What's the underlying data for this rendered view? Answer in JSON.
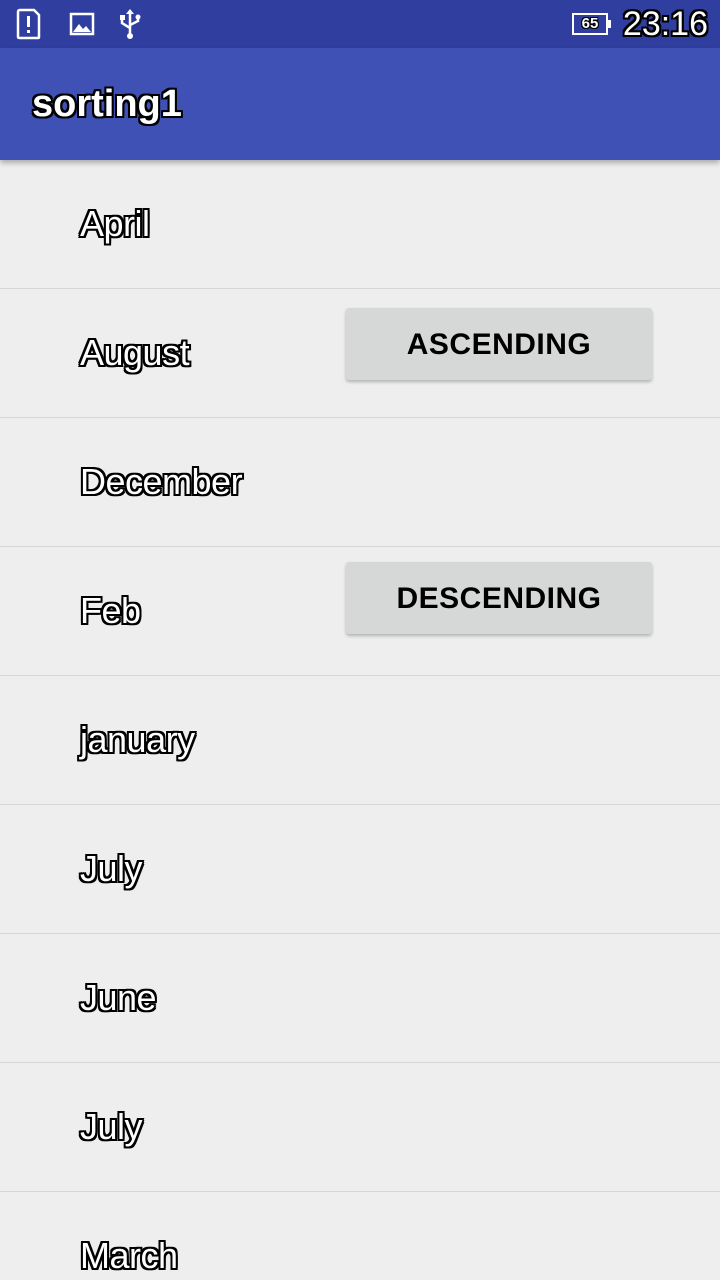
{
  "status_bar": {
    "icons": [
      "sim-alert-icon",
      "image-icon",
      "usb-icon"
    ],
    "battery_level": "65",
    "time": "23:16",
    "colors": {
      "background": "#303f9f"
    }
  },
  "app_bar": {
    "title": "sorting1",
    "colors": {
      "background": "#3f51b5"
    }
  },
  "list": {
    "items": [
      "April",
      "August",
      "December",
      "Feb",
      "january",
      "July",
      "June",
      "July",
      "March"
    ]
  },
  "buttons": {
    "ascending_label": "ASCENDING",
    "descending_label": "DESCENDING"
  }
}
